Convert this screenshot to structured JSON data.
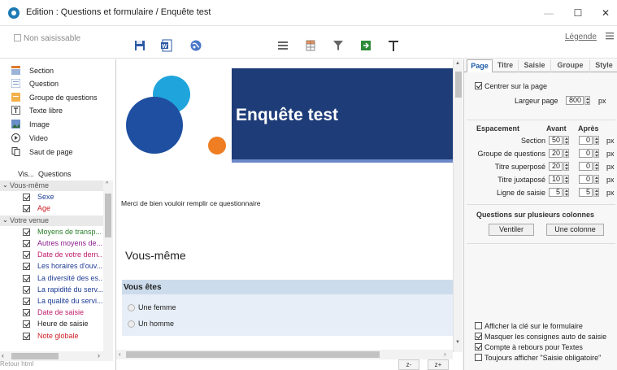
{
  "window": {
    "title": "Edition : Questions et formulaire / Enquête test",
    "minimize": "—",
    "maximize": "☐",
    "close": "✕"
  },
  "toolbar": {
    "non_saisissable": "Non saisissable",
    "legend": "Légende",
    "icons": [
      "save-icon",
      "word-icon",
      "globe-icon",
      "list-icon",
      "table-icon",
      "filter-icon",
      "export-icon",
      "text-icon"
    ]
  },
  "palette": {
    "items": [
      {
        "label": "Section",
        "icon": "section-icon"
      },
      {
        "label": "Question",
        "icon": "question-icon"
      },
      {
        "label": "Groupe de questions",
        "icon": "group-icon"
      },
      {
        "label": "Texte libre",
        "icon": "free-text-icon"
      },
      {
        "label": "Image",
        "icon": "image-icon"
      },
      {
        "label": "Video",
        "icon": "video-icon"
      },
      {
        "label": "Saut de page",
        "icon": "page-break-icon"
      }
    ]
  },
  "questions_header": {
    "vis": "Vis...",
    "questions": "Questions"
  },
  "question_list": [
    {
      "type": "group",
      "label": "Vous-même"
    },
    {
      "type": "item",
      "label": "Sexe",
      "color": "#1e3c96"
    },
    {
      "type": "item",
      "label": "Age",
      "color": "#d0202a"
    },
    {
      "type": "group",
      "label": "Votre venue"
    },
    {
      "type": "item",
      "label": "Moyens de transp...",
      "color": "#2a7d2a"
    },
    {
      "type": "item",
      "label": "Autres moyens de...",
      "color": "#8b1c8b"
    },
    {
      "type": "item",
      "label": "Date de votre dern...",
      "color": "#c21c6b"
    },
    {
      "type": "item",
      "label": "Les horaires d'ouv...",
      "color": "#1e3c96"
    },
    {
      "type": "item",
      "label": "La diversité des es...",
      "color": "#1e3c96"
    },
    {
      "type": "item",
      "label": "La rapidité du serv...",
      "color": "#1e3c96"
    },
    {
      "type": "item",
      "label": "La qualité du servi...",
      "color": "#1e3c96"
    },
    {
      "type": "item",
      "label": "Date de saisie",
      "color": "#c21c6b"
    },
    {
      "type": "item",
      "label": "Heure de saisie",
      "color": "#222222"
    },
    {
      "type": "item",
      "label": "Note globale",
      "color": "#d0202a"
    }
  ],
  "retour": "Retour html",
  "form": {
    "title": "Enquête test",
    "intro": "Merci de bien vouloir remplir ce questionnaire",
    "section": "Vous-même",
    "question": "Vous êtes",
    "options": [
      "Une femme",
      "Un homme"
    ]
  },
  "zoom": {
    "out": "z-",
    "in": "z+"
  },
  "right_panel": {
    "tabs": [
      "Page",
      "Titre",
      "Saisie",
      "Groupe",
      "Style"
    ],
    "active_tab": "Page",
    "center_page": "Centrer sur la page",
    "page_width_label": "Largeur page",
    "page_width": "800",
    "unit": "px",
    "spacing_label": "Espacement",
    "avant": "Avant",
    "apres": "Après",
    "spacing_rows": [
      {
        "label": "Section",
        "avant": "50",
        "apres": "0"
      },
      {
        "label": "Groupe de questions",
        "avant": "20",
        "apres": "0"
      },
      {
        "label": "Titre superposé",
        "avant": "20",
        "apres": "0"
      },
      {
        "label": "Titre juxtaposé",
        "avant": "10",
        "apres": "0"
      },
      {
        "label": "Ligne de saisie",
        "avant": "5",
        "apres": "5"
      }
    ],
    "multi_columns": "Questions sur plusieurs colonnes",
    "ventiler": "Ventiler",
    "une_colonne": "Une colonne",
    "bottom_checks": [
      {
        "label": "Afficher la clé sur le formulaire",
        "checked": false
      },
      {
        "label": "Masquer les consignes auto de saisie",
        "checked": true
      },
      {
        "label": "Compte à rebours pour Textes",
        "checked": true
      },
      {
        "label": "Toujours afficher \"Saisie obligatoire\"",
        "checked": false
      }
    ]
  },
  "colors": {
    "banner": "#1e3c78",
    "accent_blue": "#1d5aa8",
    "circle_dark": "#1e4fa0",
    "circle_light": "#1fa4dc",
    "circle_orange": "#ef7d22",
    "question_bg": "#e7eef7"
  }
}
